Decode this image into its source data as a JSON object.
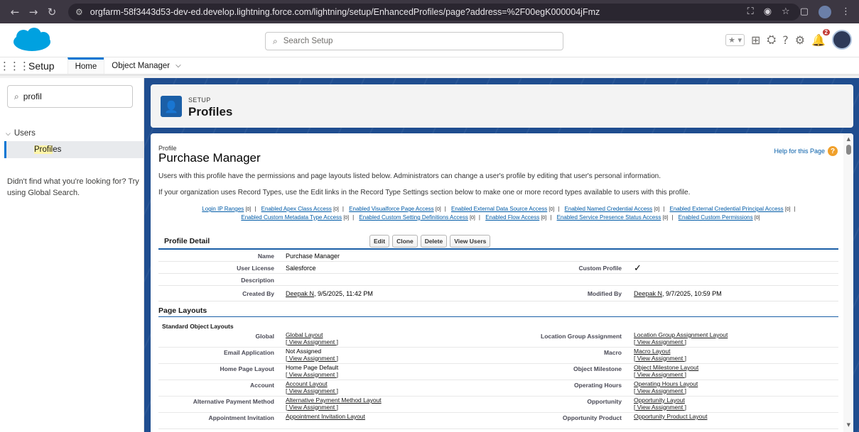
{
  "browser": {
    "url": "orgfarm-58f3443d53-dev-ed.develop.lightning.force.com/lightning/setup/EnhancedProfiles/page?address=%2F00egK000004jFmz"
  },
  "header": {
    "search_placeholder": "Search Setup",
    "notification_count": "2"
  },
  "app_nav": {
    "app_name": "Setup",
    "tabs": [
      {
        "label": "Home"
      },
      {
        "label": "Object Manager"
      }
    ]
  },
  "sidebar": {
    "search_value": "profil",
    "group_label": "Users",
    "item_label_highlight": "Profil",
    "item_label_rest": "es",
    "help_text": "Didn't find what you're looking for? Try using Global Search."
  },
  "page_header": {
    "section": "SETUP",
    "title": "Profiles"
  },
  "profile": {
    "label": "Profile",
    "name": "Purchase Manager",
    "help_link": "Help for this Page",
    "description_1": "Users with this profile have the permissions and page layouts listed below. Administrators can change a user's profile by editing that user's personal information.",
    "description_2": "If your organization uses Record Types, use the Edit links in the Record Type Settings section below to make one or more record types available to users with this profile.",
    "related_links_row1": [
      {
        "label": "Login IP Ranges",
        "count": "[0]"
      },
      {
        "label": "Enabled Apex Class Access",
        "count": "[0]"
      },
      {
        "label": "Enabled Visualforce Page Access",
        "count": "[0]"
      },
      {
        "label": "Enabled External Data Source Access",
        "count": "[0]"
      },
      {
        "label": "Enabled Named Credential Access",
        "count": "[0]"
      },
      {
        "label": "Enabled External Credential Principal Access",
        "count": "[0]"
      }
    ],
    "related_links_row2": [
      {
        "label": "Enabled Custom Metadata Type Access",
        "count": "[0]"
      },
      {
        "label": "Enabled Custom Setting Definitions Access",
        "count": "[0]"
      },
      {
        "label": "Enabled Flow Access",
        "count": "[0]"
      },
      {
        "label": "Enabled Service Presence Status Access",
        "count": "[0]"
      },
      {
        "label": "Enabled Custom Permissions",
        "count": "[0]"
      }
    ],
    "detail_title": "Profile Detail",
    "buttons": {
      "edit": "Edit",
      "clone": "Clone",
      "delete": "Delete",
      "view_users": "View Users"
    },
    "fields": {
      "name_label": "Name",
      "name_value": "Purchase Manager",
      "license_label": "User License",
      "license_value": "Salesforce",
      "custom_label": "Custom Profile",
      "custom_value": "✓",
      "description_label": "Description",
      "created_label": "Created By",
      "created_value": "Deepak N",
      "created_date": ", 9/5/2025, 11:42 PM",
      "modified_label": "Modified By",
      "modified_value": "Deepak N",
      "modified_date": ", 9/7/2025, 10:59 PM"
    },
    "page_layouts_title": "Page Layouts",
    "standard_layouts_title": "Standard Object Layouts",
    "view_assignment": "[ View Assignment ]",
    "layouts": [
      {
        "left_label": "Global",
        "left_value": "Global Layout",
        "right_label": "Location Group Assignment",
        "right_value": "Location Group Assignment Layout"
      },
      {
        "left_label": "Email Application",
        "left_value": "Not Assigned",
        "right_label": "Macro",
        "right_value": "Macro Layout"
      },
      {
        "left_label": "Home Page Layout",
        "left_value": "Home Page Default",
        "right_label": "Object Milestone",
        "right_value": "Object Milestone Layout"
      },
      {
        "left_label": "Account",
        "left_value": "Account Layout",
        "right_label": "Operating Hours",
        "right_value": "Operating Hours Layout"
      },
      {
        "left_label": "Alternative Payment Method",
        "left_value": "Alternative Payment Method Layout",
        "right_label": "Opportunity",
        "right_value": "Opportunity Layout"
      },
      {
        "left_label": "Appointment Invitation",
        "left_value": "Appointment Invitation Layout",
        "right_label": "Opportunity Product",
        "right_value": "Opportunity Product Layout"
      }
    ]
  }
}
